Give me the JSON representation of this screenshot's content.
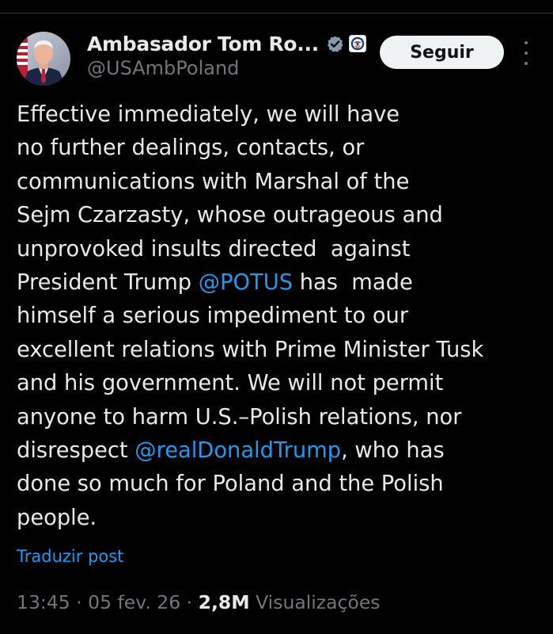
{
  "author": {
    "display_name": "Ambasador Tom Ro...",
    "handle": "@USAmbPoland",
    "verified_badge_icon": "verified-check-icon",
    "affiliation_icon": "us-department-of-state-seal-icon",
    "badge_color": "#829aab"
  },
  "actions": {
    "follow_label": "Seguir",
    "more_icon": "more-vertical-icon"
  },
  "tweet": {
    "lines": [
      [
        {
          "text": "Effective immediately, we will have"
        }
      ],
      [
        {
          "text": "no further dealings, contacts, or"
        }
      ],
      [
        {
          "text": "communications with Marshal of the"
        }
      ],
      [
        {
          "text": "Sejm Czarzasty, whose outrageous and"
        }
      ],
      [
        {
          "text": "unprovoked insults directed  against"
        }
      ],
      [
        {
          "text": "President Trump "
        },
        {
          "text": "@POTUS",
          "mention": true
        },
        {
          "text": " has  made"
        }
      ],
      [
        {
          "text": "himself a serious impediment to our"
        }
      ],
      [
        {
          "text": "excellent relations with Prime Minister Tusk"
        }
      ],
      [
        {
          "text": "and his government. We will not permit"
        }
      ],
      [
        {
          "text": "anyone to harm U.S.–Polish relations, nor"
        }
      ],
      [
        {
          "text": "disrespect "
        },
        {
          "text": "@realDonaldTrump",
          "mention": true
        },
        {
          "text": ", who has"
        }
      ],
      [
        {
          "text": "done so much for Poland and the Polish"
        }
      ],
      [
        {
          "text": "people."
        }
      ]
    ],
    "translate_label": "Traduzir post"
  },
  "meta": {
    "time": "13:45",
    "separator": " · ",
    "date": "05 fev. 26",
    "views_count": "2,8M",
    "views_label": "Visualizações"
  },
  "colors": {
    "background": "#000000",
    "text": "#e7e9ea",
    "secondary": "#71767b",
    "link": "#1d9bf0",
    "follow_bg": "#eff3f4"
  }
}
